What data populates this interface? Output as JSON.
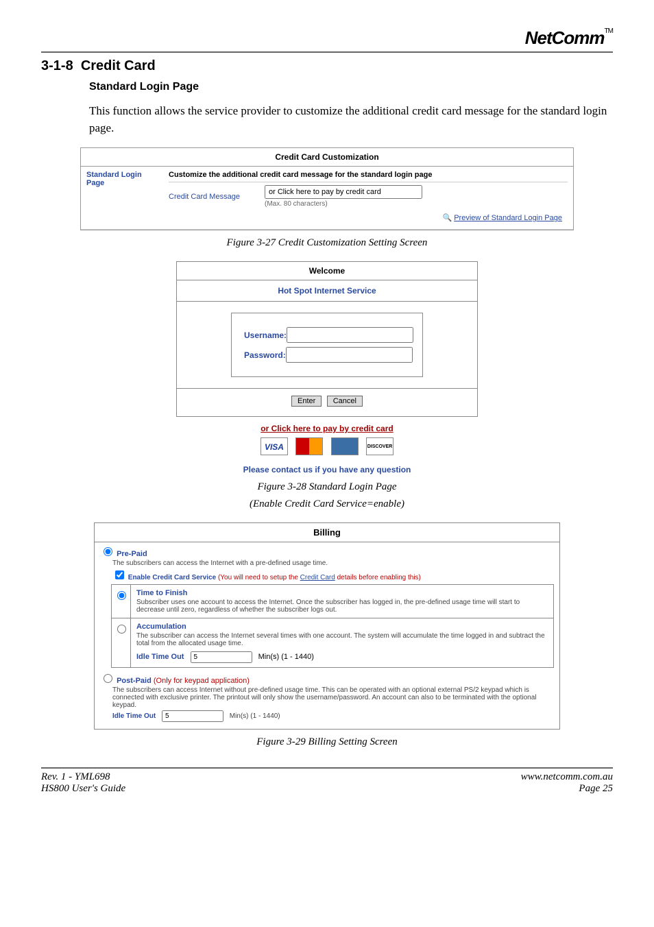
{
  "logo": {
    "text": "NetComm",
    "tm": "TM"
  },
  "section": {
    "number": "3-1-8",
    "title": "Credit Card"
  },
  "subhead": "Standard Login Page",
  "description": "This function allows the service provider to customize the additional credit card message for the standard login page.",
  "fig27": {
    "title": "Credit Card Customization",
    "left_label": "Standard Login Page",
    "customize_text": "Customize the additional credit card message for the standard login page",
    "msg_label": "Credit Card Message",
    "msg_value": "or Click here to pay by credit card",
    "msg_hint": "(Max. 80 characters)",
    "preview_link": "Preview of Standard Login Page",
    "caption": "Figure 3-27 Credit Customization Setting Screen"
  },
  "fig28": {
    "welcome": "Welcome",
    "service": "Hot Spot Internet Service",
    "username_label": "Username:",
    "password_label": "Password:",
    "enter_btn": "Enter",
    "cancel_btn": "Cancel",
    "cc_link": "or Click here to pay by credit card",
    "cards": {
      "visa": "VISA",
      "mc": "MasterCard",
      "amex": "AMERICAN EXPRESS",
      "disc": "DISCOVER"
    },
    "contact": "Please contact us if you have any question",
    "caption1": "Figure 3-28 Standard Login Page",
    "caption2": "(Enable Credit Card Service=enable)"
  },
  "fig29": {
    "title": "Billing",
    "prepaid": {
      "label": "Pre-Paid",
      "desc": "The subscribers can access the Internet with a pre-defined usage time.",
      "enable_cc_prefix": "Enable Credit Card Service",
      "enable_cc_suffix": " (You will need to setup the ",
      "enable_cc_link": "Credit Card",
      "enable_cc_after": " details before enabling this)",
      "time_to_finish": {
        "title": "Time to Finish",
        "desc": "Subscriber uses one account to access the Internet.  Once the subscriber has logged in, the pre-defined usage time will start to decrease until zero, regardless of whether the subscriber logs out."
      },
      "accumulation": {
        "title": "Accumulation",
        "desc": "The subscriber can access the Internet several times with one account. The system will accumulate the time logged in and subtract the total from the allocated usage time.",
        "idle_label": "Idle Time Out",
        "idle_value": "5",
        "idle_unit": "Min(s) (1 - 1440)"
      }
    },
    "postpaid": {
      "label": "Post-Paid",
      "only_keypad": "  (Only for keypad application)",
      "desc": "The subscribers can access Internet without pre-defined usage time. This can be operated with an optional external PS/2 keypad which is connected with exclusive printer. The printout will only show the username/password. An account can also to be terminated with the optional keypad.",
      "idle_label": "Idle Time Out",
      "idle_value": "5",
      "idle_unit": "Min(s) (1 - 1440)"
    },
    "caption": "Figure 3-29 Billing Setting Screen"
  },
  "footer": {
    "left1": "Rev. 1 - YML698",
    "left2": "HS800 User's Guide",
    "right1": "www.netcomm.com.au",
    "right2": "Page 25"
  }
}
